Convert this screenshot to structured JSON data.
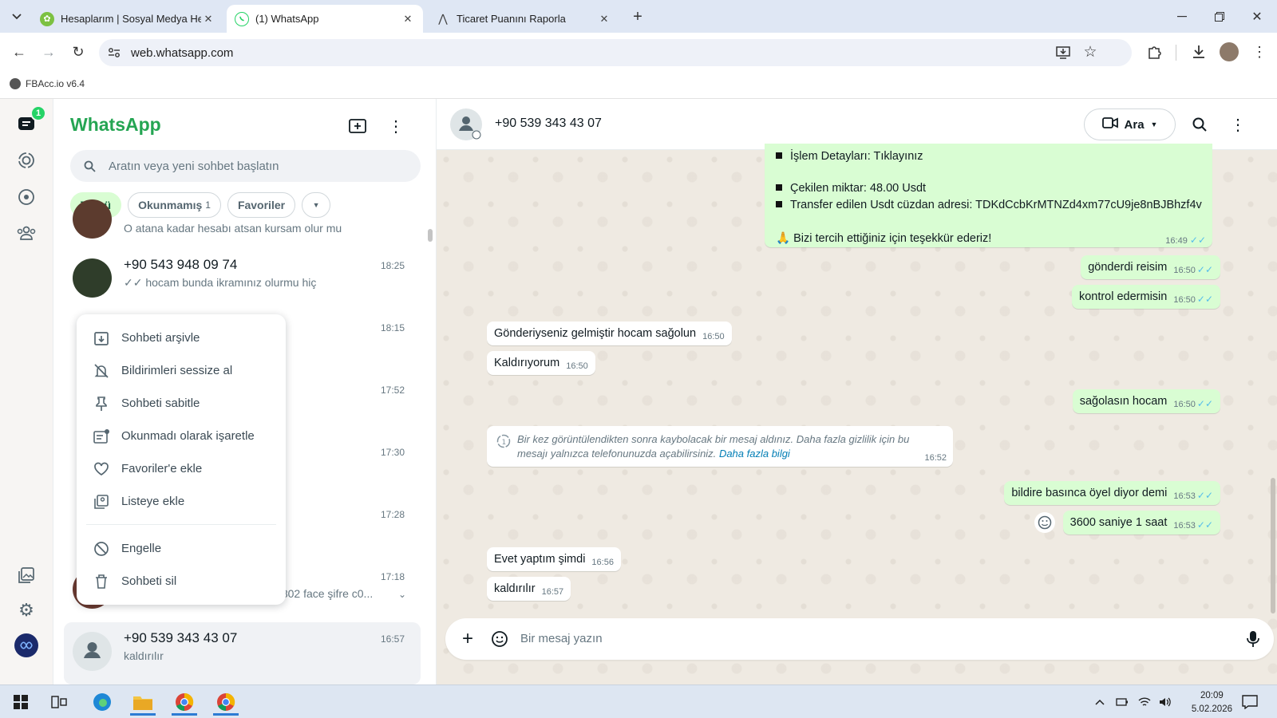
{
  "browser": {
    "tabs": [
      {
        "title": "Hesaplarım | Sosyal Medya Hes",
        "active": false
      },
      {
        "title": "(1) WhatsApp",
        "active": true
      },
      {
        "title": "Ticaret Puanını Raporla",
        "active": false
      }
    ],
    "url": "web.whatsapp.com",
    "bookmark": "FBAcc.io v6.4"
  },
  "whatsapp": {
    "title": "WhatsApp",
    "unread_badge": "1",
    "search_placeholder": "Aratın veya yeni sohbet başlatın",
    "chips": {
      "all": "Tümü",
      "unread": "Okunmamış",
      "unread_count": "1",
      "favorites": "Favoriler"
    },
    "chats": [
      {
        "name": "",
        "time": "",
        "preview": "O atana kadar hesabı atsan kursam olur mu"
      },
      {
        "name": "+90 543 948 09 74",
        "time": "18:25",
        "preview": "✓✓ hocam bunda ikramınız olurmu hiç"
      },
      {
        "name": "",
        "time": "18:15",
        "preview": ""
      },
      {
        "name": "",
        "time": "17:52",
        "preview": ""
      },
      {
        "name": "",
        "time": "17:30",
        "preview": ""
      },
      {
        "name": "",
        "time": "17:28",
        "preview": ""
      },
      {
        "name": "",
        "time": "17:18",
        "preview": "✓✓ Kullanıcı adı: 61573849832802 face şifre c0..."
      },
      {
        "name": "+90 539 343 43 07",
        "time": "16:57",
        "preview": "kaldırılır"
      }
    ],
    "context_menu": [
      "Sohbeti arşivle",
      "Bildirimleri sessize al",
      "Sohbeti sabitle",
      "Okunmadı olarak işaretle",
      "Favoriler'e ekle",
      "Listeye ekle",
      "Engelle",
      "Sohbeti sil"
    ],
    "conversation": {
      "contact": "+90 539 343 43 07",
      "call_label": "Ara",
      "big_message": {
        "lines": [
          "İşlem Detayları: Tıklayınız",
          "Çekilen miktar: 48.00 Usdt",
          "Transfer edilen Usdt cüzdan adresi: TDKdCcbKrMTNZd4xm77cU9je8nBJBhzf4v",
          "🙏 Bizi tercih ettiğiniz için teşekkür ederiz!"
        ],
        "time": "16:49"
      },
      "messages": [
        {
          "text": "gönderdi reisim",
          "time": "16:50",
          "dir": "out"
        },
        {
          "text": "kontrol edermisin",
          "time": "16:50",
          "dir": "out"
        },
        {
          "text": "Gönderiyseniz gelmiştir hocam sağolun",
          "time": "16:50",
          "dir": "in"
        },
        {
          "text": "Kaldırıyorum",
          "time": "16:50",
          "dir": "in"
        },
        {
          "text": "sağolasın hocam",
          "time": "16:50",
          "dir": "out"
        },
        {
          "text": "bildire basınca öyel diyor demi",
          "time": "16:53",
          "dir": "out"
        },
        {
          "text": "3600 saniye 1 saat",
          "time": "16:53",
          "dir": "out"
        },
        {
          "text": "Evet yaptım şimdi",
          "time": "16:56",
          "dir": "in"
        },
        {
          "text": "kaldırılır",
          "time": "16:57",
          "dir": "in"
        }
      ],
      "system_message": {
        "text": "Bir kez görüntülendikten sonra kaybolacak bir mesaj aldınız. Daha fazla gizlilik için bu mesajı yalnızca telefonunuzda açabilirsiniz.",
        "link": "Daha fazla bilgi",
        "time": "16:52"
      },
      "composer_placeholder": "Bir mesaj yazın"
    }
  },
  "taskbar": {
    "time": "20:09",
    "date": "5.02.2026"
  },
  "colors": {
    "brand": "#25a553",
    "out_bubble": "#d9fdd3",
    "chat_bg": "#efeae2",
    "read_ticks": "#53bdeb"
  }
}
